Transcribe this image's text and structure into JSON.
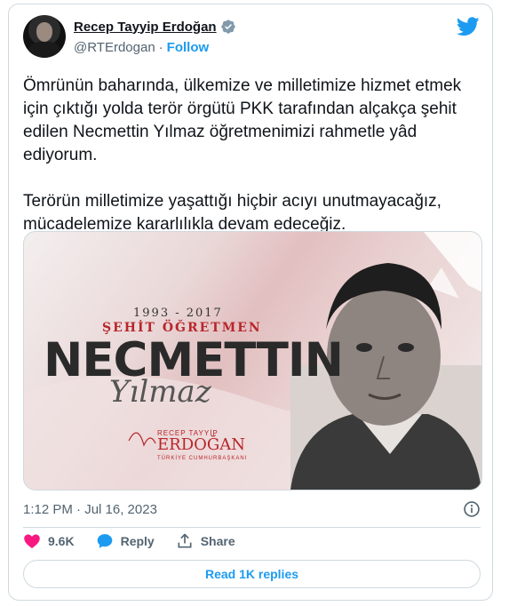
{
  "author": {
    "name": "Recep Tayyip Erdoğan",
    "handle": "@RTErdogan",
    "separator": "·",
    "follow_label": "Follow"
  },
  "tweet": {
    "text": "Ömrünün baharında, ülkemize ve milletimize hizmet etmek için çıktığı yolda terör örgütü PKK tarafından alçakça şehit edilen Necmettin Yılmaz öğretmenimizi rahmetle yâd ediyorum.\n\nTerörün milletimize yaşattığı hiçbir acıyı unutmayacağız, mücadelemize kararlılıkla devam edeceğiz."
  },
  "media": {
    "years": "1993 - 2017",
    "subtitle": "ŞEHİT ÖĞRETMEN",
    "first_name": "NECMETTIN",
    "last_name": "Yılmaz",
    "signature_top": "RECEP TAYYİP",
    "signature_main": "ERDOĞAN",
    "signature_sub": "TÜRKİYE CUMHURBAŞKANI"
  },
  "meta": {
    "timestamp": "1:12 PM · Jul 16, 2023"
  },
  "actions": {
    "likes": "9.6K",
    "reply_label": "Reply",
    "share_label": "Share"
  },
  "replies_button": "Read 1K replies",
  "colors": {
    "accent": "#1d9bf0",
    "like": "#f91880",
    "text_secondary": "#536471",
    "border": "#cfd9de"
  },
  "icons": [
    "verified-badge-icon",
    "twitter-bird-icon",
    "info-icon",
    "heart-icon",
    "reply-bubble-icon",
    "share-icon"
  ]
}
